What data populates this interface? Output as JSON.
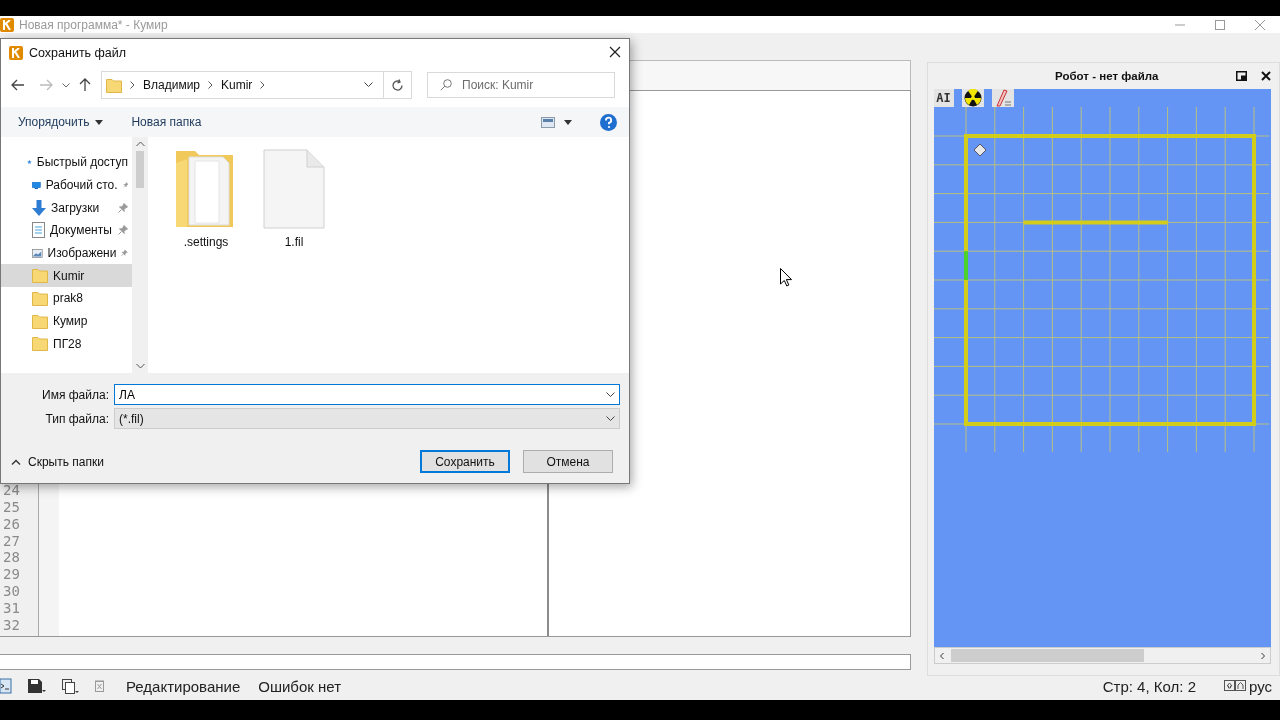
{
  "window": {
    "title": "Новая программа* - Кумир"
  },
  "dialog": {
    "title": "Сохранить файл",
    "breadcrumb": [
      "Владимир",
      "Kumir"
    ],
    "search": {
      "placeholder": "Поиск: Kumir"
    },
    "toolbar": [
      {
        "label": "Упорядочить",
        "dropdown": true
      },
      {
        "label": "Новая папка",
        "dropdown": false
      }
    ],
    "nav_items": [
      {
        "label": "Быстрый доступ",
        "kind": "quick-access",
        "pinned": false,
        "selected": false,
        "children": [
          {
            "label": "Рабочий сто.",
            "kind": "desktop",
            "pinned": true,
            "selected": false
          },
          {
            "label": "Загрузки",
            "kind": "downloads",
            "pinned": true,
            "selected": false
          },
          {
            "label": "Документы",
            "kind": "documents",
            "pinned": true,
            "selected": false
          },
          {
            "label": "Изображени",
            "kind": "pictures",
            "pinned": true,
            "selected": false
          },
          {
            "label": "Kumir",
            "kind": "folder",
            "pinned": false,
            "selected": true
          },
          {
            "label": "prak8",
            "kind": "folder",
            "pinned": false,
            "selected": false
          },
          {
            "label": "Кумир",
            "kind": "folder",
            "pinned": false,
            "selected": false
          },
          {
            "label": "ПГ28",
            "kind": "folder",
            "pinned": false,
            "selected": false
          }
        ]
      }
    ],
    "files": [
      {
        "name": ".settings",
        "kind": "folder"
      },
      {
        "name": "1.fil",
        "kind": "file"
      }
    ],
    "file_name": {
      "label": "Имя файла:",
      "value": "ЛА"
    },
    "file_type": {
      "label": "Тип файла:",
      "value": "(*.fil)"
    },
    "hide_folders": "Скрыть папки",
    "buttons": [
      {
        "label": "Сохранить",
        "default": true
      },
      {
        "label": "Отмена",
        "default": false
      }
    ]
  },
  "editor": {
    "line_numbers": [
      "24",
      "25",
      "26",
      "27",
      "28",
      "29",
      "30",
      "31",
      "32"
    ]
  },
  "robot": {
    "title": "Робот - нет файла",
    "tools": [
      {
        "kind": "text",
        "label": "AI"
      },
      {
        "kind": "radiation"
      },
      {
        "kind": "pen"
      }
    ]
  },
  "status_bar": {
    "mode": "Редактирование",
    "errors": "Ошибок нет",
    "position": "Стр: 4, Кол: 2",
    "language": "рус"
  }
}
